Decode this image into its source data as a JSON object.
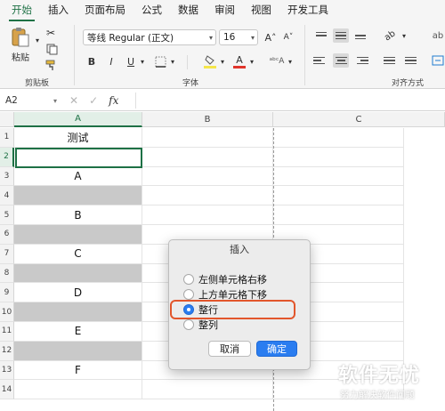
{
  "ribbon": {
    "tabs": [
      "开始",
      "插入",
      "页面布局",
      "公式",
      "数据",
      "审阅",
      "视图",
      "开发工具"
    ],
    "active_tab": 0,
    "clipboard": {
      "paste_label": "粘贴",
      "group_label": "剪贴板"
    },
    "font": {
      "name": "等线 Regular (正文)",
      "size": "16",
      "grow": "A˄",
      "shrink": "A˅",
      "bold": "B",
      "italic": "I",
      "underline": "U",
      "group_label": "字体",
      "accent_color": "#f5e64a",
      "font_color": "#e0352b"
    },
    "alignment": {
      "group_label": "对齐方式"
    }
  },
  "formula_bar": {
    "cell_ref": "A2",
    "fx": "fx",
    "cancel_icon": "close-icon",
    "confirm_icon": "check-icon"
  },
  "sheet": {
    "columns": [
      "A",
      "B",
      "C"
    ],
    "rows": [
      "1",
      "2",
      "3",
      "4",
      "5",
      "6",
      "7",
      "8",
      "9",
      "10",
      "11",
      "12",
      "13",
      "14"
    ],
    "cells_a": [
      "测试",
      "",
      "A",
      "",
      "B",
      "",
      "C",
      "",
      "D",
      "",
      "E",
      "",
      "F",
      ""
    ],
    "gray_rows": [
      4,
      6,
      8,
      10,
      12
    ],
    "selected_cell": "A2"
  },
  "dialog": {
    "title": "插入",
    "options": [
      "左侧单元格右移",
      "上方单元格下移",
      "整行",
      "整列"
    ],
    "selected_option": 2,
    "cancel": "取消",
    "ok": "确定",
    "accent": "#2a7df0",
    "highlight_color": "#e2562c"
  },
  "watermark": {
    "title": "软件无忧",
    "subtitle": "努力解决软件问题"
  }
}
